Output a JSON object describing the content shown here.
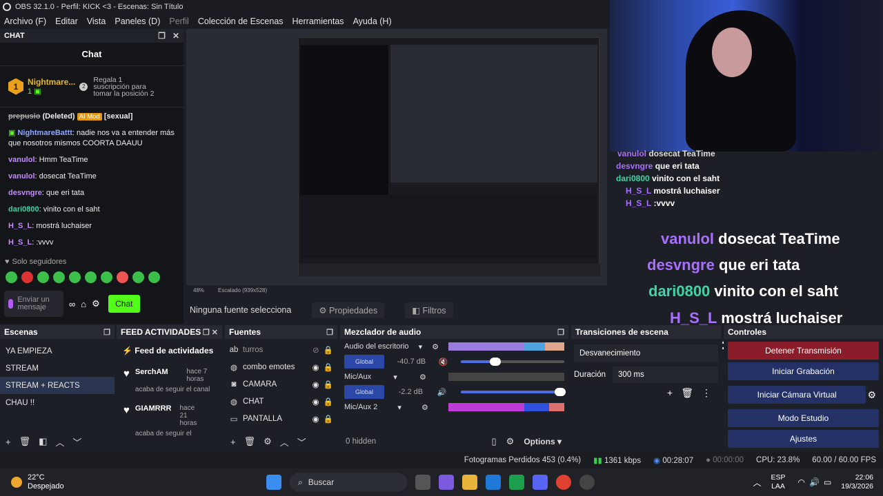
{
  "window": {
    "title": "OBS 32.1.0 - Perfil: KICK <3 - Escenas: Sin Título"
  },
  "menu": [
    "Archivo (F)",
    "Editar",
    "Vista",
    "Paneles (D)",
    "Perfil",
    "Colección de Escenas",
    "Herramientas",
    "Ayuda (H)"
  ],
  "chat_dock": {
    "header": "CHAT",
    "title": "Chat",
    "pinned": {
      "name": "Nightmare...",
      "count": "1",
      "badge": "1",
      "message": "Regala 1 suscripción para tomar la posición 2"
    },
    "messages": [
      {
        "user": "prepusio",
        "deleted_tag": "(Deleted)",
        "mod_tag": "AI Mod",
        "text": "[sexual]"
      },
      {
        "user": "NightmareBattt",
        "text": "nadie nos va a entender más que nosotros mismos COORTA DAAUU"
      },
      {
        "user": "vanulol",
        "text": "Hmm TeaTime"
      },
      {
        "user": "vanulol",
        "text": "dosecat TeaTime"
      },
      {
        "user": "desvngre",
        "text": "que eri tata"
      },
      {
        "user": "dari0800",
        "text": "vinito con el saht"
      },
      {
        "user": "H_S_L",
        "text": "mostrá luchaiser"
      },
      {
        "user": "H_S_L",
        "text": ":vvvv"
      }
    ],
    "followers_label": "Solo seguidores",
    "input_placeholder": "Enviar un mensaje",
    "chat_button": "Chat"
  },
  "overlay_chat": [
    {
      "user": "vanulol",
      "text": "dosecat TeaTime",
      "color": "#a970ff"
    },
    {
      "user": "desvngre",
      "text": "que eri tata",
      "color": "#a970ff"
    },
    {
      "user": "dari0800",
      "text": "vinito con el saht",
      "color": "#3fd4a6"
    },
    {
      "user": "H_S_L",
      "text": "mostrá luchaiser",
      "color": "#a970ff"
    },
    {
      "user": "H_S_L",
      "text": ":vvvv",
      "color": "#a970ff"
    }
  ],
  "preview_strip": {
    "zoom": "48%",
    "scale": "Escalado (939x528)"
  },
  "source_bar": {
    "no_source": "Ninguna fuente selecciona",
    "properties": "Propiedades",
    "filters": "Filtros"
  },
  "scenes": {
    "header": "Escenas",
    "items": [
      "YA EMPIEZA",
      "STREAM",
      "STREAM + REACTS",
      "CHAU !!"
    ],
    "selected": "STREAM + REACTS"
  },
  "feed": {
    "header": "FEED ACTIVIDADES",
    "title": "Feed de actividades",
    "items": [
      {
        "user": "SerchAM",
        "time": "hace 7 horas",
        "action": "acaba de seguir el canal"
      },
      {
        "user": "GIAMRRR",
        "time": "hace 21 horas",
        "action": "acaba de seguir el"
      }
    ]
  },
  "sources": {
    "header": "Fuentes",
    "items": [
      "turros",
      "combo emotes",
      "CAMARA",
      "CHAT",
      "PANTALLA"
    ]
  },
  "mixer": {
    "header": "Mezclador de audio",
    "channels": [
      {
        "name": "Audio del escritorio",
        "db": "-40.7 dB",
        "level": 0.32
      },
      {
        "name": "Mic/Aux",
        "db": "-2.2 dB",
        "level": 0.94
      },
      {
        "name": "Mic/Aux 2",
        "db": "",
        "level": 0
      }
    ],
    "global_label": "Global",
    "scale": [
      "-60",
      "-54",
      "-48",
      "-42",
      "-36",
      "-30",
      "-24",
      "-18",
      "-12",
      "-6",
      "0"
    ],
    "hidden": "0 hidden",
    "options": "Options"
  },
  "transitions": {
    "header": "Transiciones de escena",
    "transition": "Desvanecimiento",
    "duration_label": "Duración",
    "duration": "300 ms"
  },
  "controls": {
    "header": "Controles",
    "buttons": [
      "Detener Transmisión",
      "Iniciar Grabación",
      "Iniciar Cámara Virtual",
      "Modo Estudio",
      "Ajustes"
    ]
  },
  "status": {
    "dropped": "Fotogramas Perdidos 453 (0.4%)",
    "kbps": "1361 kbps",
    "live_time": "00:28:07",
    "rec_time": "00:00:00",
    "cpu": "CPU: 23.8%",
    "fps": "60.00 / 60.00 FPS"
  },
  "taskbar": {
    "temp": "22°C",
    "weather": "Despejado",
    "search": "Buscar",
    "lang1": "ESP",
    "lang2": "LAA",
    "time": "22:06",
    "date": "19/3/2026"
  }
}
